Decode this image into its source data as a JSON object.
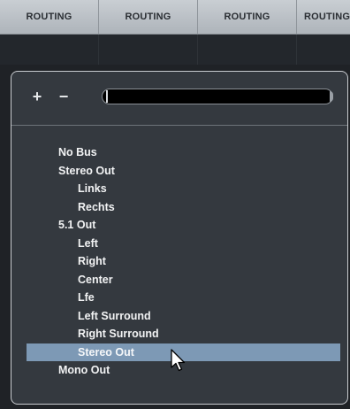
{
  "columns": [
    "ROUTING",
    "ROUTING",
    "ROUTING",
    "ROUTING"
  ],
  "toolbar": {
    "add_label": "+",
    "remove_label": "−",
    "search_value": ""
  },
  "list": [
    {
      "label": "No Bus",
      "level": 0,
      "selected": false
    },
    {
      "label": "Stereo Out",
      "level": 0,
      "selected": false
    },
    {
      "label": "Links",
      "level": 1,
      "selected": false
    },
    {
      "label": "Rechts",
      "level": 1,
      "selected": false
    },
    {
      "label": "5.1 Out",
      "level": 0,
      "selected": false
    },
    {
      "label": "Left",
      "level": 1,
      "selected": false
    },
    {
      "label": "Right",
      "level": 1,
      "selected": false
    },
    {
      "label": "Center",
      "level": 1,
      "selected": false
    },
    {
      "label": "Lfe",
      "level": 1,
      "selected": false
    },
    {
      "label": "Left Surround",
      "level": 1,
      "selected": false
    },
    {
      "label": "Right Surround",
      "level": 1,
      "selected": false
    },
    {
      "label": "Stereo Out",
      "level": 1,
      "selected": true
    },
    {
      "label": "Mono Out",
      "level": 0,
      "selected": false
    }
  ],
  "colors": {
    "selection": "#7d99b5",
    "panel_bg": "#34393f",
    "header_bg": "#bfc4c9"
  },
  "icons": {
    "cursor": "mouse-pointer-icon"
  }
}
